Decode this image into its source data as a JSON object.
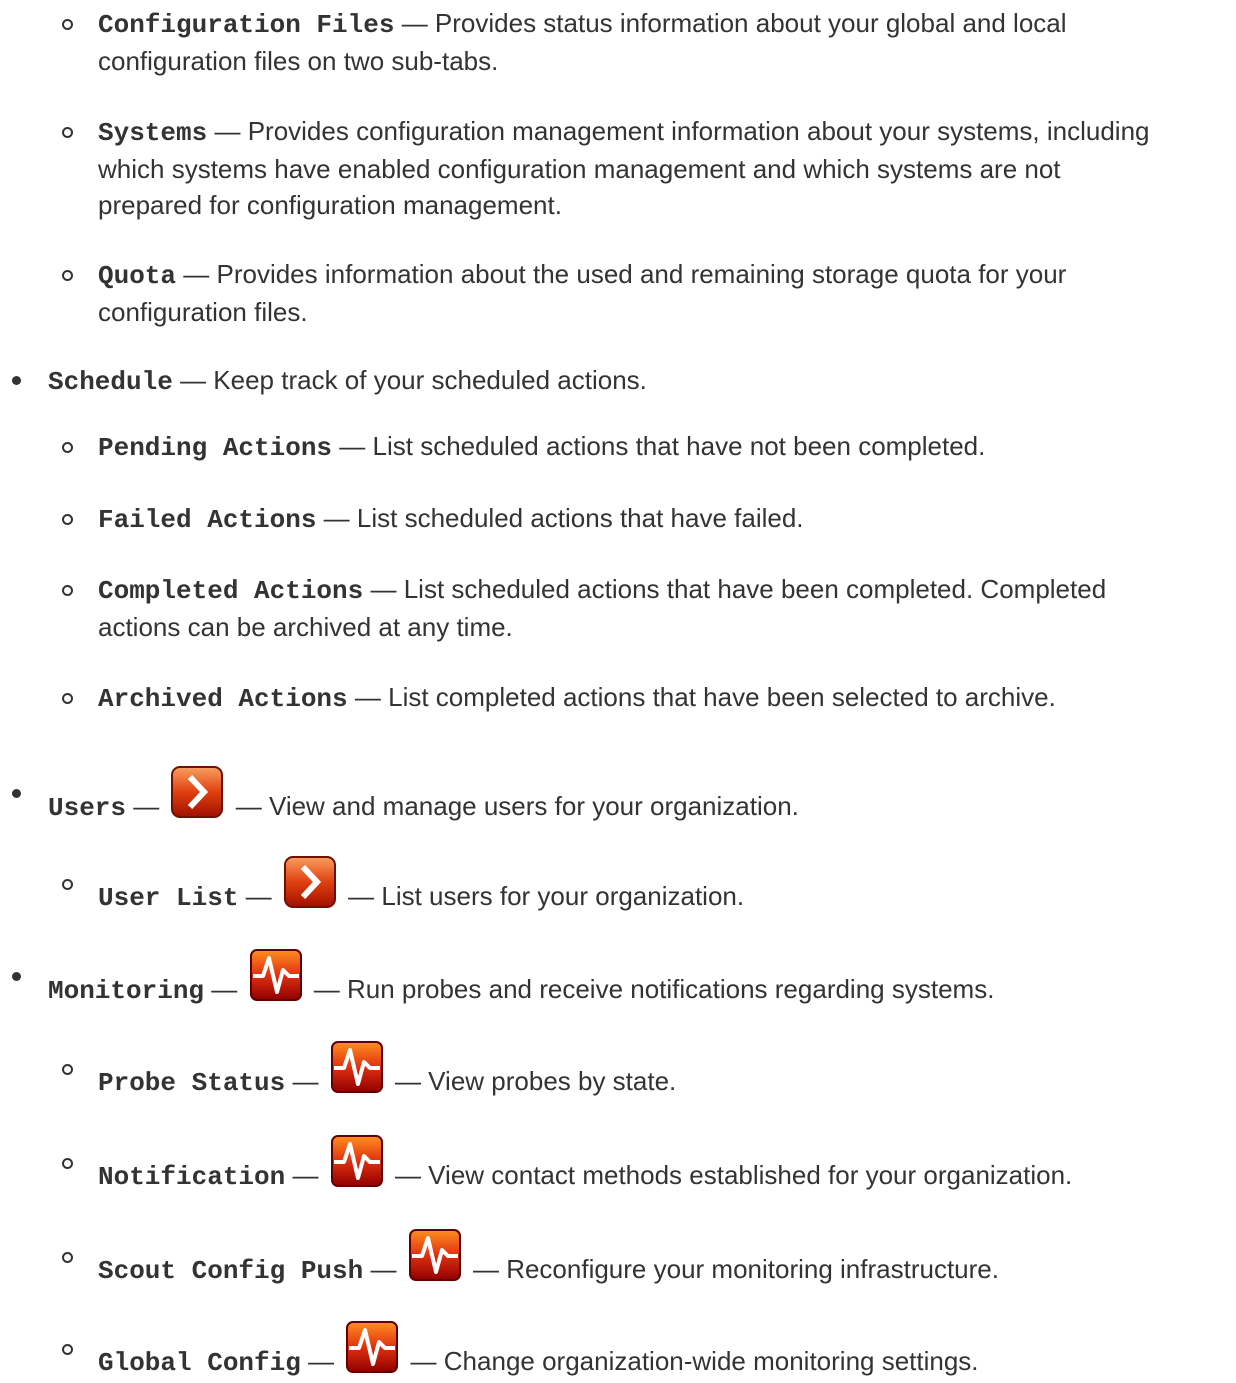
{
  "dash": "—",
  "items": [
    {
      "level": 2,
      "term": "Configuration Files",
      "lines": [
        "Provides status information about your global and local",
        "configuration files on two sub-tabs."
      ]
    },
    {
      "level": 2,
      "term": "Systems",
      "lines": [
        "Provides configuration management information about your systems, including",
        "which systems have enabled configuration management and which systems are not",
        "prepared for configuration management."
      ]
    },
    {
      "level": 2,
      "term": "Quota",
      "lines": [
        "Provides information about the used and remaining storage quota for your",
        "configuration files."
      ]
    },
    {
      "level": 1,
      "term": "Schedule",
      "lines": [
        "Keep track of your scheduled actions."
      ]
    },
    {
      "level": 2,
      "term": "Pending Actions",
      "lines": [
        "List scheduled actions that have not been completed."
      ]
    },
    {
      "level": 2,
      "term": "Failed Actions",
      "lines": [
        "List scheduled actions that have failed."
      ]
    },
    {
      "level": 2,
      "term": "Completed Actions",
      "lines": [
        "List scheduled actions that have been completed. Completed",
        "actions can be archived at any time."
      ]
    },
    {
      "level": 2,
      "term": "Archived Actions",
      "lines": [
        "List completed actions that have been selected to archive."
      ]
    },
    {
      "level": 1,
      "term": "Users",
      "icon": "provisioning-chevron-icon",
      "lines": [
        "View and manage users for your organization."
      ]
    },
    {
      "level": 2,
      "term": "User List",
      "icon": "provisioning-chevron-icon",
      "lines": [
        "List users for your organization."
      ]
    },
    {
      "level": 1,
      "term": "Monitoring",
      "icon": "monitoring-pulse-icon",
      "lines": [
        "Run probes and receive notifications regarding systems."
      ]
    },
    {
      "level": 2,
      "term": "Probe Status",
      "icon": "monitoring-pulse-icon",
      "lines": [
        "View probes by state."
      ]
    },
    {
      "level": 2,
      "term": "Notification",
      "icon": "monitoring-pulse-icon",
      "lines": [
        "View contact methods established for your organization."
      ]
    },
    {
      "level": 2,
      "term": "Scout Config Push",
      "icon": "monitoring-pulse-icon",
      "lines": [
        "Reconfigure your monitoring infrastructure."
      ]
    },
    {
      "level": 2,
      "term": "Global Config",
      "icon": "monitoring-pulse-icon",
      "lines": [
        "Change organization-wide monitoring settings."
      ]
    }
  ],
  "colors": {
    "text": "#333333",
    "icon_red": "#cc2200",
    "icon_orange": "#f07010"
  }
}
